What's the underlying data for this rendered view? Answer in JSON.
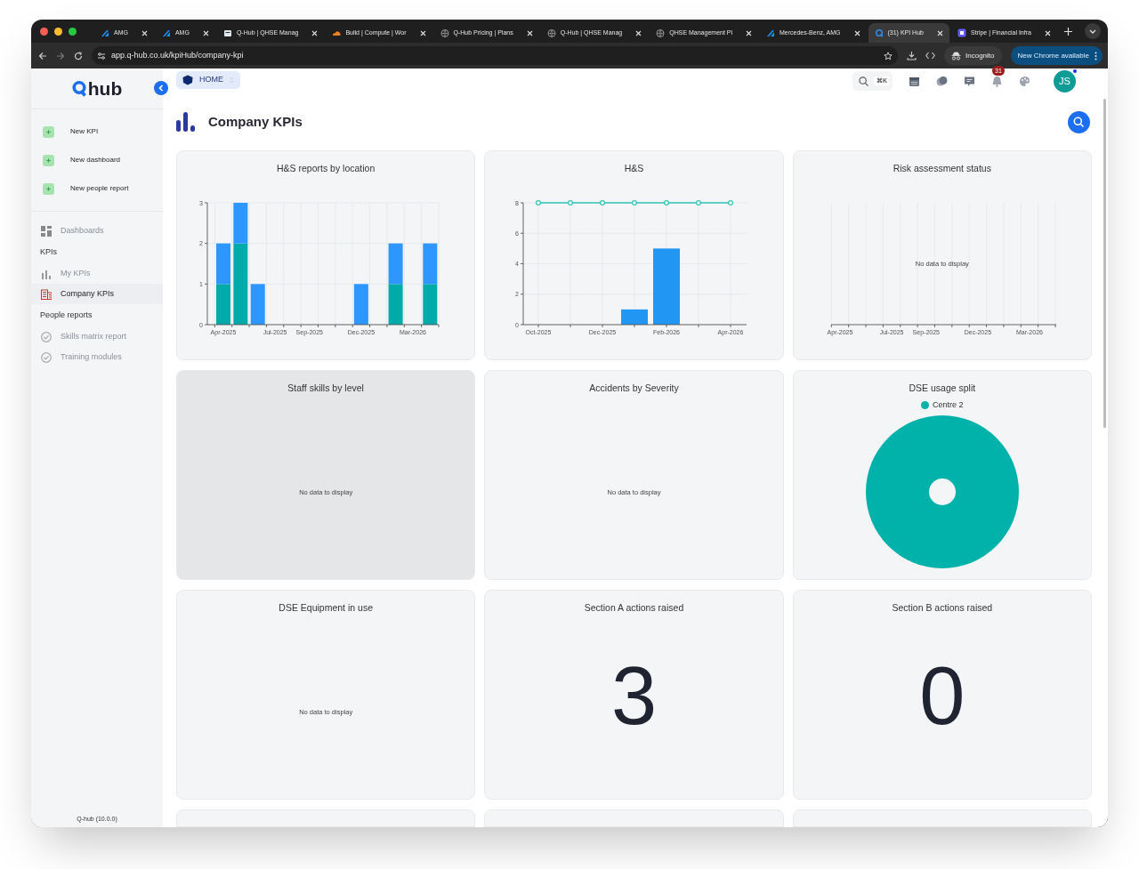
{
  "browser": {
    "tabs": [
      {
        "title": "AMG",
        "selected": false
      },
      {
        "title": "AMG",
        "selected": false
      },
      {
        "title": "Q-Hub | QHSE Manag",
        "selected": false
      },
      {
        "title": "Build | Compute | Wor",
        "selected": false
      },
      {
        "title": "Q-Hub Pricing | Plans",
        "selected": false
      },
      {
        "title": "Q-Hub | QHSE Manag",
        "selected": false
      },
      {
        "title": "QHSE Management Pl",
        "selected": false
      },
      {
        "title": "Mercedes-Benz, AMG",
        "selected": false
      },
      {
        "title": "(31) KPI Hub",
        "selected": true
      },
      {
        "title": "Stripe | Financial Infra",
        "selected": false
      }
    ],
    "url": "app.q-hub.co.uk/kpiHub/company-kpi",
    "profile": "Incognito",
    "update_button": "New Chrome available"
  },
  "sidebar": {
    "logo": "hub",
    "actions": [
      "New KPI",
      "New dashboard",
      "New people report"
    ],
    "nav": [
      {
        "kind": "link",
        "label": "Dashboards",
        "selected": false
      },
      {
        "kind": "section",
        "label": "KPIs"
      },
      {
        "kind": "link",
        "label": "My KPIs",
        "selected": false
      },
      {
        "kind": "link",
        "label": "Company KPIs",
        "selected": true
      },
      {
        "kind": "section",
        "label": "People reports"
      },
      {
        "kind": "link",
        "label": "Skills matrix report",
        "selected": false
      },
      {
        "kind": "link",
        "label": "Training modules",
        "selected": false
      }
    ],
    "version": "Q-hub (10.0.0)"
  },
  "header": {
    "breadcrumb": "HOME",
    "shortcut": "⌘K",
    "notification_count": "31",
    "avatar": "JS"
  },
  "page": {
    "title": "Company KPIs"
  },
  "cards": [
    {
      "kind": "chart",
      "title": "H&S reports by location",
      "chart_data": {
        "type": "bar",
        "stacked": true,
        "categories": [
          "Apr-2025",
          null,
          null,
          "Jul-2025",
          null,
          "Sep-2025",
          null,
          null,
          "Dec-2025",
          null,
          null,
          "Mar-2026",
          null
        ],
        "series": [
          {
            "color": "#00aba9",
            "values": [
              1,
              2,
              0,
              0,
              0,
              0,
              0,
              0,
              0,
              0,
              1,
              0,
              1
            ]
          },
          {
            "color": "#2d96ff",
            "values": [
              1,
              1,
              1,
              0,
              0,
              0,
              0,
              0,
              1,
              0,
              1,
              0,
              1
            ]
          }
        ],
        "ylim": [
          0,
          3
        ],
        "yticks": [
          0,
          1,
          2,
          3
        ],
        "grid": true
      }
    },
    {
      "kind": "chart",
      "title": "H&S",
      "chart_data": {
        "type": "bar",
        "categories": [
          "Oct-2025",
          null,
          "Dec-2025",
          null,
          "Feb-2026",
          null,
          "Apr-2026"
        ],
        "series": [
          {
            "type": "bar",
            "color": "#2196f3",
            "values": [
              0,
              0,
              0,
              1,
              5,
              0,
              0
            ]
          },
          {
            "type": "line",
            "color": "#2ec4b6",
            "marker": true,
            "values": [
              8,
              8,
              8,
              8,
              8,
              8,
              8
            ]
          }
        ],
        "ylim": [
          0,
          8
        ],
        "yticks": [
          0,
          2,
          4,
          6,
          8
        ],
        "grid": true
      }
    },
    {
      "kind": "empty_axis",
      "title": "Risk assessment status",
      "message": "No data to display",
      "chart_data": {
        "type": "other",
        "categories": [
          "Apr-2025",
          null,
          null,
          "Jul-2025",
          null,
          "Sep-2025",
          null,
          null,
          "Dec-2025",
          null,
          null,
          "Mar-2026",
          null
        ]
      }
    },
    {
      "kind": "empty",
      "title": "Staff skills by level",
      "message": "No data to display",
      "selected": true
    },
    {
      "kind": "empty",
      "title": "Accidents by Severity",
      "message": "No data to display",
      "selected": false
    },
    {
      "kind": "donut",
      "title": "DSE usage split",
      "chart_data": {
        "type": "pie",
        "categories": [
          "Centre 2"
        ],
        "series": [
          {
            "color": "#00b2aa",
            "values": [
              1
            ]
          }
        ]
      }
    },
    {
      "kind": "empty",
      "title": "DSE Equipment in use",
      "message": "No data to display",
      "selected": false
    },
    {
      "kind": "number",
      "title": "Section A actions raised",
      "value": "3"
    },
    {
      "kind": "number",
      "title": "Section B actions raised",
      "value": "0"
    }
  ]
}
